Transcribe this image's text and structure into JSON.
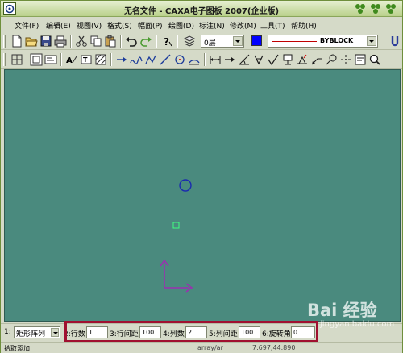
{
  "window": {
    "title": "无名文件 - CAXA电子图板 2007(企业版)",
    "app_icon": "caxa-app-icon",
    "controls": [
      "minimize-icon",
      "maximize-icon",
      "close-icon"
    ]
  },
  "menubar": {
    "items": [
      {
        "label": "文件(F)"
      },
      {
        "label": "编辑(E)"
      },
      {
        "label": "视图(V)"
      },
      {
        "label": "格式(S)"
      },
      {
        "label": "幅面(P)"
      },
      {
        "label": "绘图(D)"
      },
      {
        "label": "标注(N)"
      },
      {
        "label": "修改(M)"
      },
      {
        "label": "工具(T)"
      },
      {
        "label": "帮助(H)"
      }
    ]
  },
  "toolbar_standard": {
    "layer_value": "0层",
    "color": "#0000ff",
    "linetype_color": "#c00000",
    "linetype_value": "BYBLOCK"
  },
  "canvas": {
    "background": "#4a8a7e",
    "objects": [
      "circle",
      "small-square",
      "coordinate-axes"
    ]
  },
  "command_bar": {
    "field1_prefix": "1:",
    "mode_value": "矩形阵列",
    "field2_label": "2:行数",
    "rows_value": "1",
    "field3_label": "3:行间距",
    "row_spacing_value": "100",
    "field4_label": "4:列数",
    "cols_value": "2",
    "field5_label": "5:列间距",
    "col_spacing_value": "100",
    "field6_label": "6:旋转角",
    "rotation_value": "0"
  },
  "statusbar": {
    "prompt": "拾取添加",
    "command": "array/ar",
    "coordinates": "7.697,44.890"
  },
  "watermark": {
    "main": "Bai 经验",
    "sub": "jingyan.baidu.com"
  }
}
